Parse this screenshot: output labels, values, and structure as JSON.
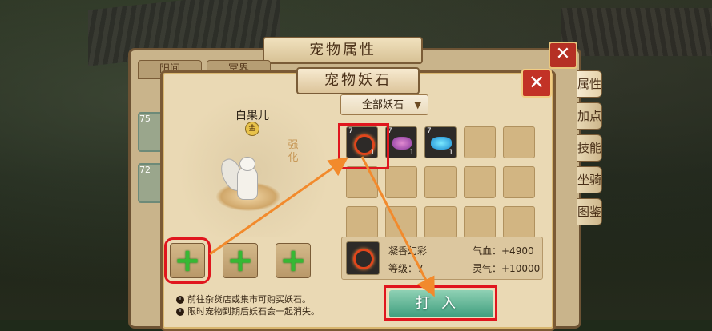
{
  "back_window": {
    "title": "宠物属性",
    "tabs": [
      "阳间",
      "冥界"
    ],
    "close_label": "✕",
    "side_tabs": [
      "属性",
      "加点",
      "技能",
      "坐骑",
      "图鉴"
    ],
    "left_slots": [
      "75",
      "72"
    ]
  },
  "dialog": {
    "title": "宠物妖石",
    "close_label": "✕",
    "pet": {
      "name": "白果儿",
      "badge": "金",
      "enhance_label": "强化"
    },
    "add_slot_glyph": "+",
    "notes": [
      "前往杂货店或集市可购买妖石。",
      "限时宠物到期后妖石会一起消失。"
    ],
    "note_icon": "!",
    "filter": {
      "label": "全部妖石",
      "arrow": "▼"
    },
    "inventory": [
      {
        "level": "7",
        "count": "1",
        "gem": "red-ring"
      },
      {
        "level": "7",
        "count": "1",
        "gem": "purple-stone"
      },
      {
        "level": "7",
        "count": "1",
        "gem": "cyan-stone"
      }
    ],
    "empty_cells": 12,
    "selected": {
      "name": "凝香幻彩",
      "level": "等级：7",
      "hp": "气血：+4900",
      "qi": "灵气：+10000"
    },
    "confirm_label": "打入"
  },
  "colors": {
    "highlight": "#e0161e",
    "arrow": "#f28a2c",
    "plus": "#37b834"
  },
  "icons": [
    "close-icon",
    "plus-icon",
    "warning-icon",
    "dropdown-arrow-icon",
    "gem-icon"
  ]
}
